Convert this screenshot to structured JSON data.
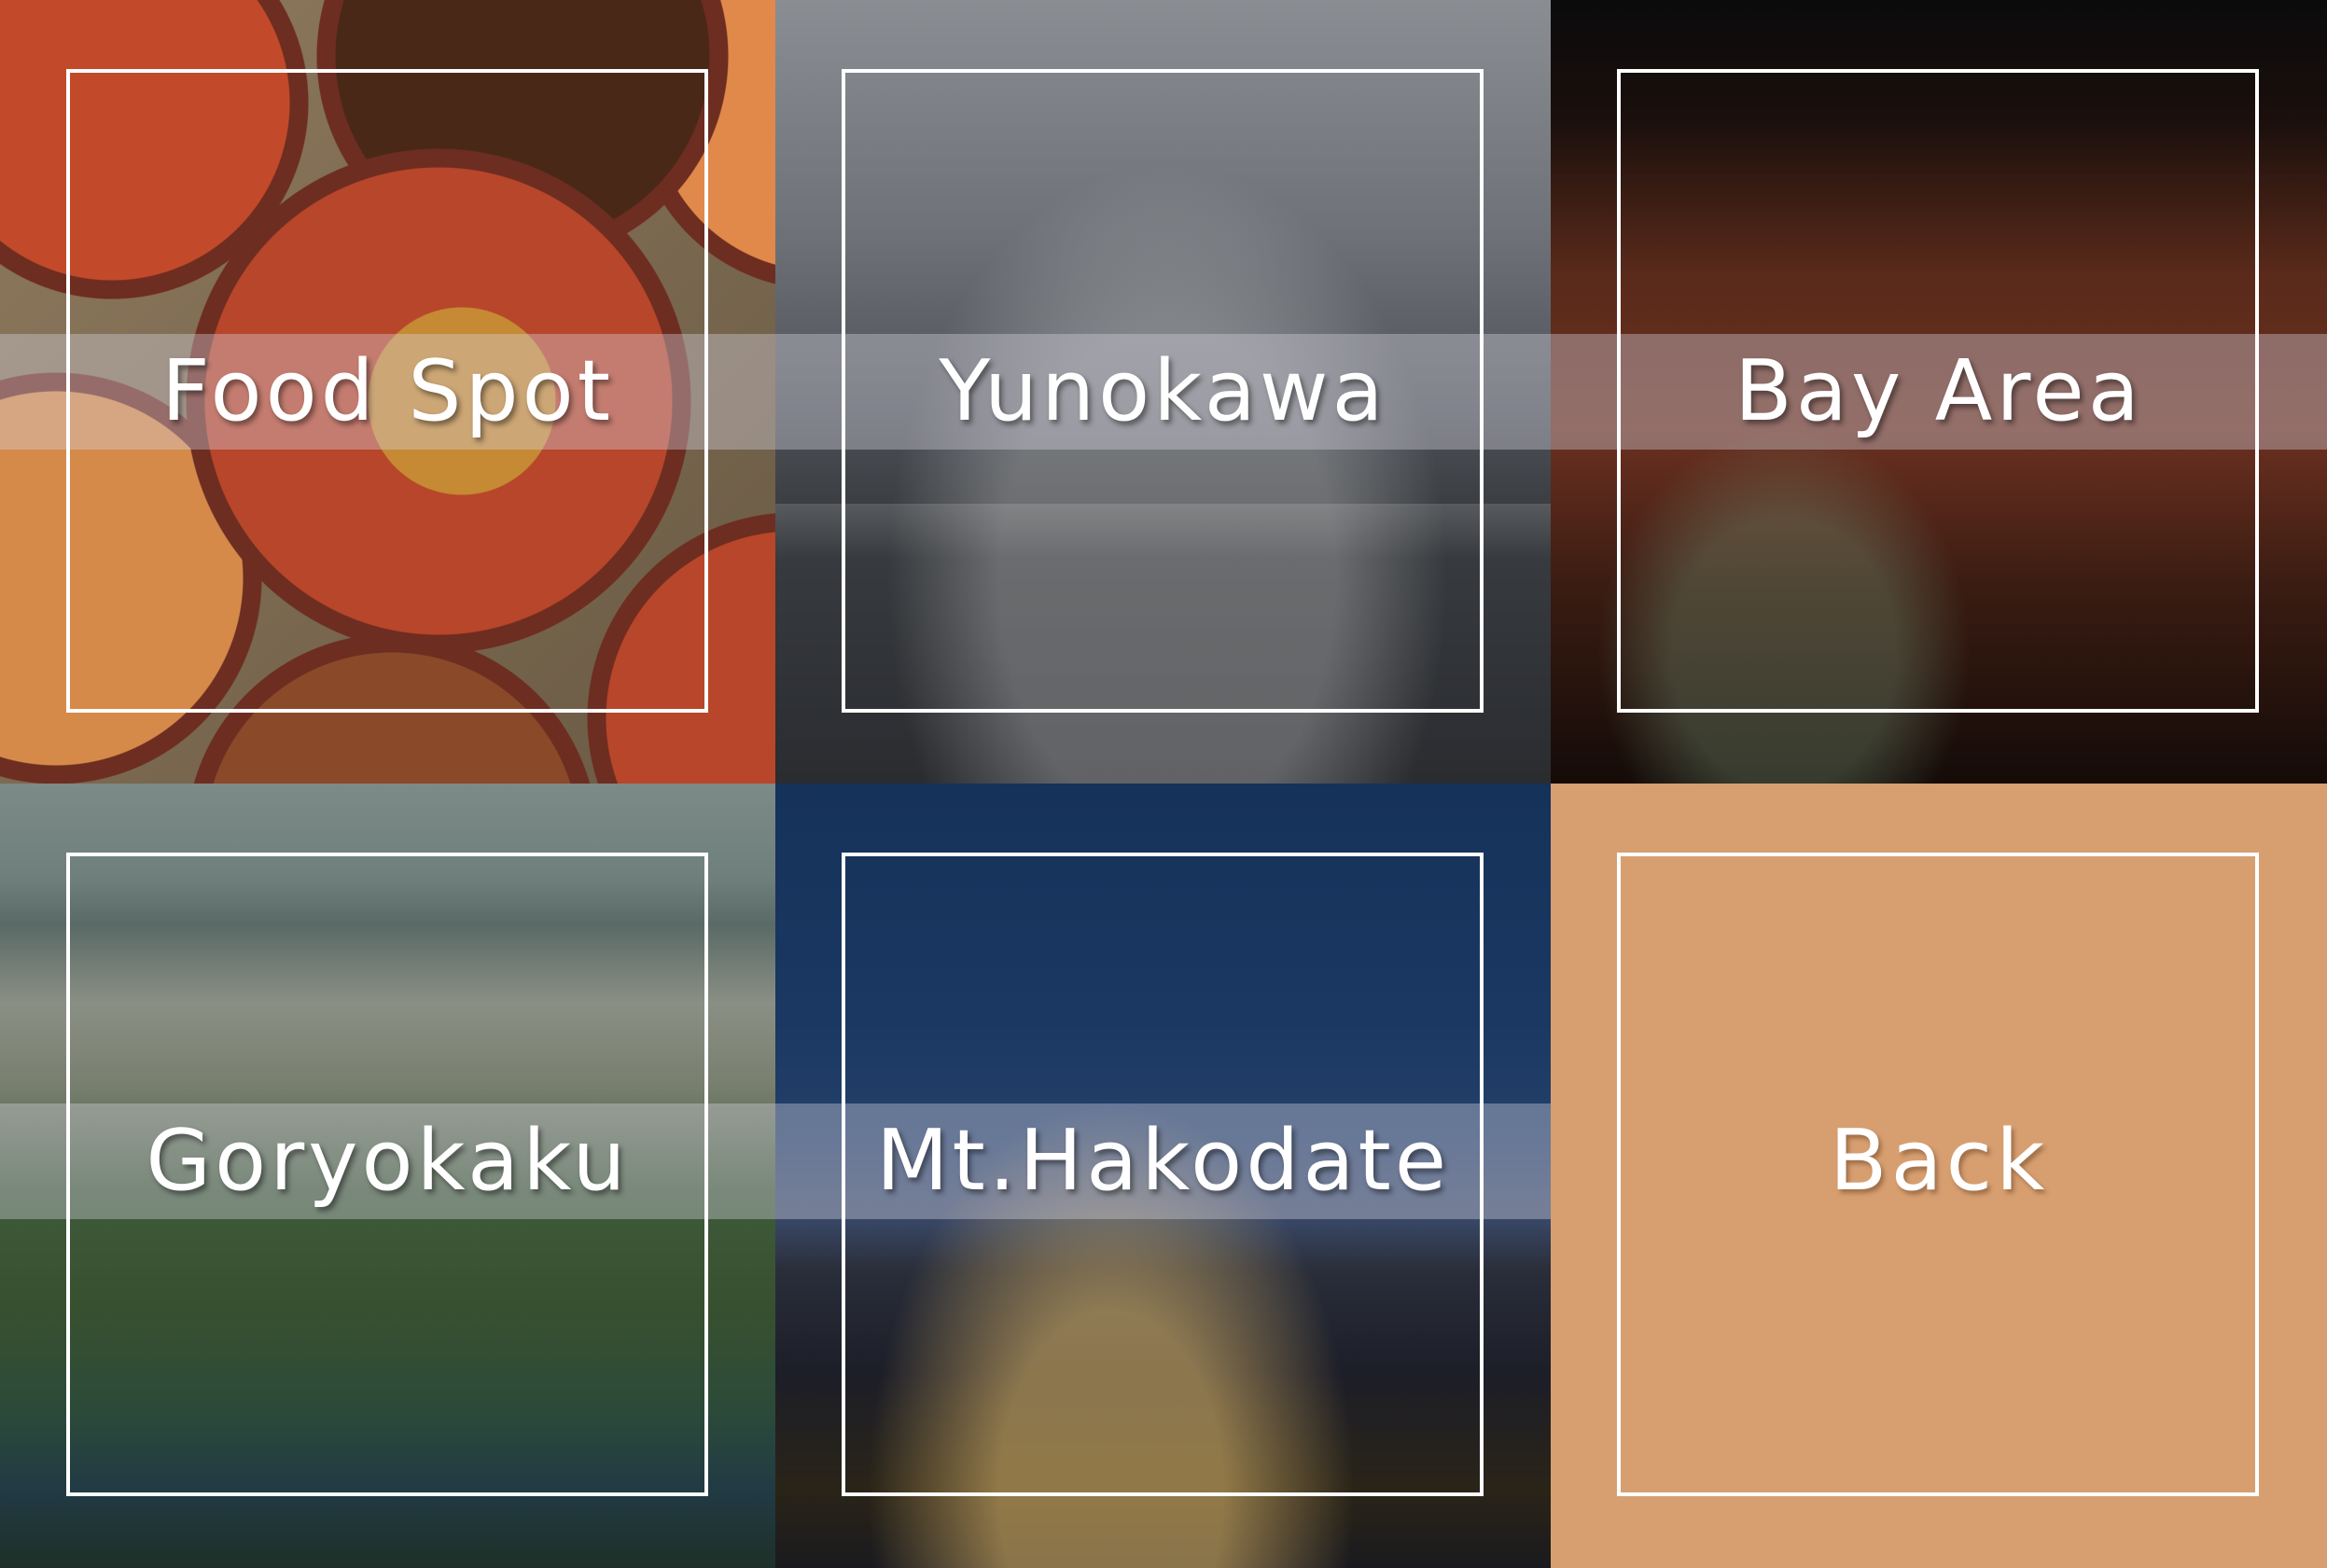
{
  "tiles": [
    {
      "id": "food-spot",
      "label": "Food Spot"
    },
    {
      "id": "yunokawa",
      "label": "Yunokawa"
    },
    {
      "id": "bay-area",
      "label": "Bay Area"
    },
    {
      "id": "goryokaku",
      "label": "Goryokaku"
    },
    {
      "id": "mt-hakodate",
      "label": "Mt.Hakodate"
    },
    {
      "id": "back",
      "label": "Back"
    }
  ],
  "colors": {
    "frame": "#ffffff",
    "label": "#ffffff",
    "back_tile": "#d79f70",
    "band": "rgba(215,212,225,0.38)"
  }
}
